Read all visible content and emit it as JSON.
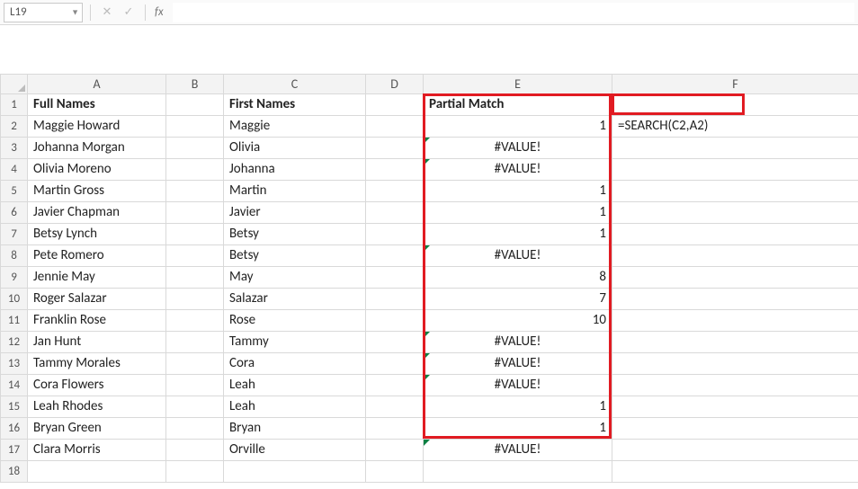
{
  "nameBox": {
    "value": "L19"
  },
  "fx": {
    "cancel_glyph": "✕",
    "confirm_glyph": "✓",
    "fx_label": "fx",
    "formula": ""
  },
  "colHeaders": [
    "A",
    "B",
    "C",
    "D",
    "E",
    "F"
  ],
  "headers": {
    "A": "Full Names",
    "C": "First Names",
    "E": "Partial Match"
  },
  "annotation": {
    "formula_text": "=SEARCH(C2,A2)"
  },
  "chart_data": {
    "type": "table",
    "title": "Excel SEARCH partial-match demo",
    "columns": [
      "Full Names",
      "First Names",
      "Partial Match (SEARCH result)"
    ],
    "rows": [
      [
        "Maggie Howard",
        "Maggie",
        1
      ],
      [
        "Johanna Morgan",
        "Olivia",
        "#VALUE!"
      ],
      [
        "Olivia Moreno",
        "Johanna",
        "#VALUE!"
      ],
      [
        "Martin Gross",
        "Martin",
        1
      ],
      [
        "Javier Chapman",
        "Javier",
        1
      ],
      [
        "Betsy Lynch",
        "Betsy",
        1
      ],
      [
        "Pete Romero",
        "Betsy",
        "#VALUE!"
      ],
      [
        "Jennie May",
        "May",
        8
      ],
      [
        "Roger Salazar",
        "Salazar",
        7
      ],
      [
        "Franklin Rose",
        "Rose",
        10
      ],
      [
        "Jan Hunt",
        "Tammy",
        "#VALUE!"
      ],
      [
        "Tammy Morales",
        "Cora",
        "#VALUE!"
      ],
      [
        "Cora Flowers",
        "Leah",
        "#VALUE!"
      ],
      [
        "Leah Rhodes",
        "Leah",
        1
      ],
      [
        "Bryan Green",
        "Bryan",
        1
      ],
      [
        "Clara Morris",
        "Orville",
        "#VALUE!"
      ]
    ]
  },
  "rows": [
    {
      "n": 2,
      "A": "Maggie Howard",
      "C": "Maggie",
      "E": "1",
      "err": false,
      "num": true
    },
    {
      "n": 3,
      "A": "Johanna Morgan",
      "C": "Olivia",
      "E": "#VALUE!",
      "err": true,
      "num": false
    },
    {
      "n": 4,
      "A": "Olivia Moreno",
      "C": "Johanna",
      "E": "#VALUE!",
      "err": true,
      "num": false
    },
    {
      "n": 5,
      "A": "Martin Gross",
      "C": "Martin",
      "E": "1",
      "err": false,
      "num": true
    },
    {
      "n": 6,
      "A": "Javier Chapman",
      "C": "Javier",
      "E": "1",
      "err": false,
      "num": true
    },
    {
      "n": 7,
      "A": "Betsy Lynch",
      "C": "Betsy",
      "E": "1",
      "err": false,
      "num": true
    },
    {
      "n": 8,
      "A": "Pete Romero",
      "C": "Betsy",
      "E": "#VALUE!",
      "err": true,
      "num": false
    },
    {
      "n": 9,
      "A": "Jennie May",
      "C": "May",
      "E": "8",
      "err": false,
      "num": true
    },
    {
      "n": 10,
      "A": "Roger Salazar",
      "C": "Salazar",
      "E": "7",
      "err": false,
      "num": true
    },
    {
      "n": 11,
      "A": "Franklin Rose",
      "C": "Rose",
      "E": "10",
      "err": false,
      "num": true
    },
    {
      "n": 12,
      "A": "Jan Hunt",
      "C": "Tammy",
      "E": "#VALUE!",
      "err": true,
      "num": false
    },
    {
      "n": 13,
      "A": "Tammy Morales",
      "C": "Cora",
      "E": "#VALUE!",
      "err": true,
      "num": false
    },
    {
      "n": 14,
      "A": "Cora Flowers",
      "C": "Leah",
      "E": "#VALUE!",
      "err": true,
      "num": false
    },
    {
      "n": 15,
      "A": "Leah Rhodes",
      "C": "Leah",
      "E": "1",
      "err": false,
      "num": true
    },
    {
      "n": 16,
      "A": "Bryan Green",
      "C": "Bryan",
      "E": "1",
      "err": false,
      "num": true
    },
    {
      "n": 17,
      "A": "Clara Morris",
      "C": "Orville",
      "E": "#VALUE!",
      "err": true,
      "num": false
    }
  ],
  "emptyRows": [
    18
  ]
}
